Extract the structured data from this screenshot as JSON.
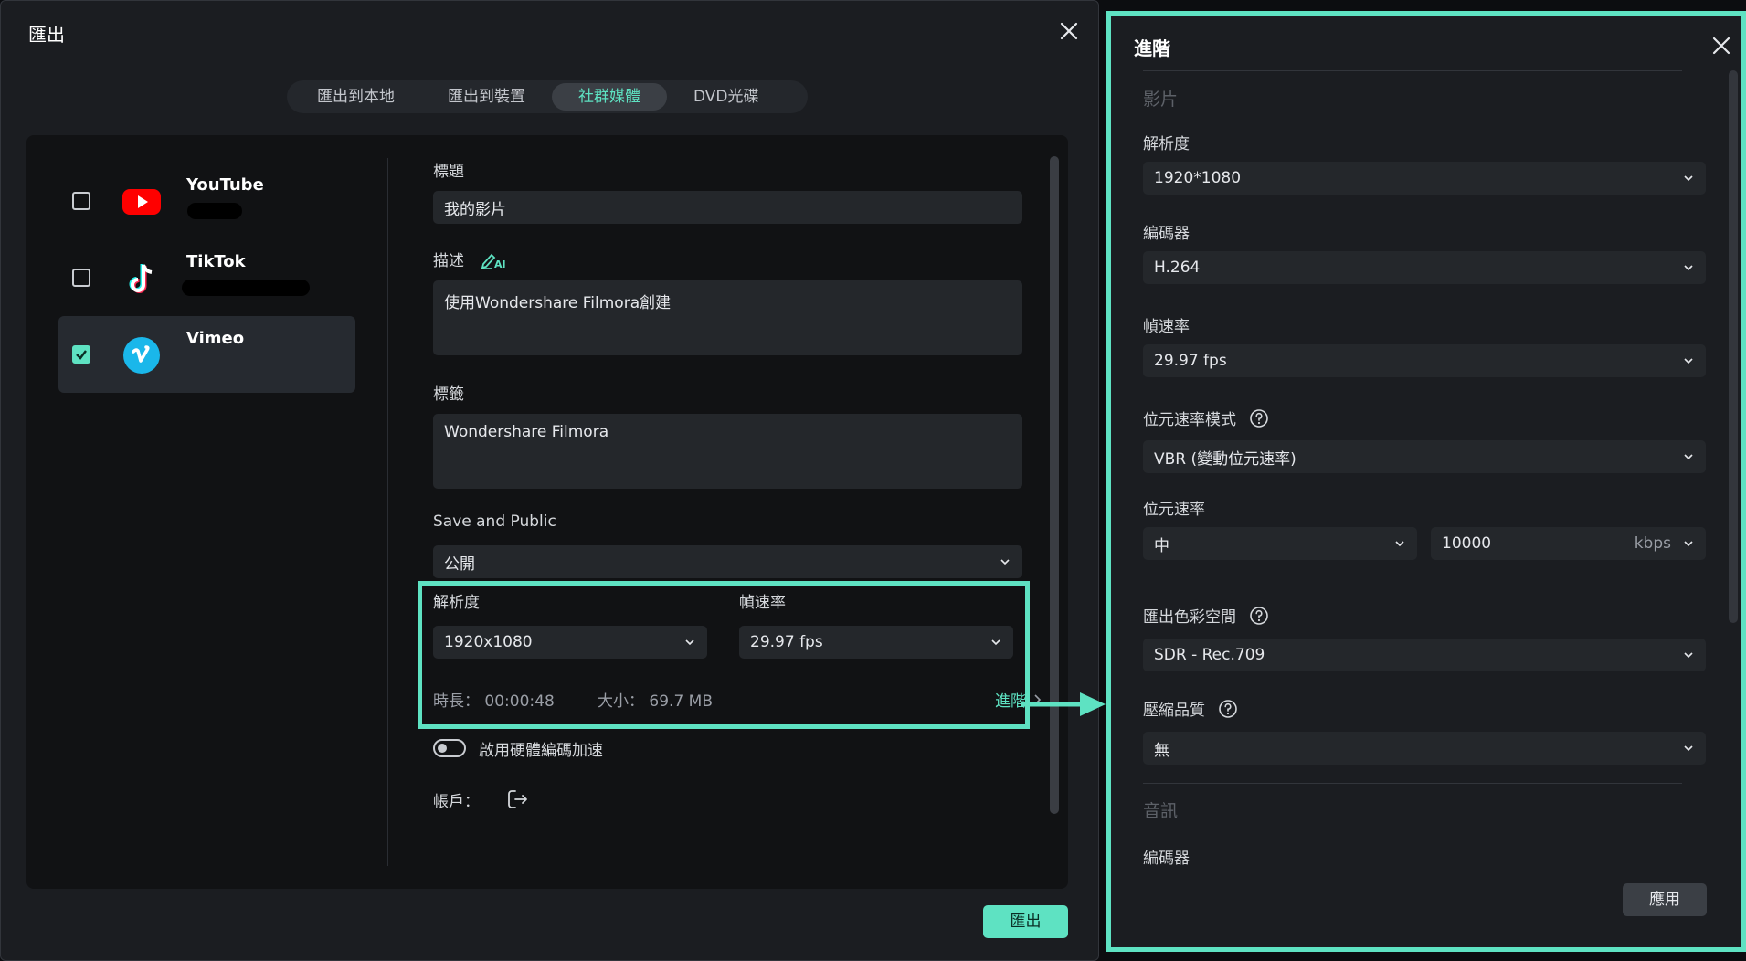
{
  "dialog": {
    "title": "匯出",
    "tabs": [
      "匯出到本地",
      "匯出到裝置",
      "社群媒體",
      "DVD光碟"
    ],
    "active_tab": "社群媒體",
    "platforms": [
      {
        "name": "YouTube",
        "checked": false
      },
      {
        "name": "TikTok",
        "checked": false
      },
      {
        "name": "Vimeo",
        "checked": true
      }
    ],
    "form": {
      "title_label": "標題",
      "title_value": "我的影片",
      "desc_label": "描述",
      "desc_value": "使用Wondershare Filmora創建",
      "tags_label": "標籤",
      "tags_value": "Wondershare Filmora",
      "privacy_label": "Save and Public",
      "privacy_value": "公開",
      "resolution_label": "解析度",
      "resolution_value": "1920x1080",
      "framerate_label": "幀速率",
      "framerate_value": "29.97 fps",
      "duration_label": "時長：",
      "duration_value": "00:00:48",
      "size_label": "大小：",
      "size_value": "69.7 MB",
      "advanced_link": "進階",
      "hw_accel_label": "啟用硬體編碼加速",
      "hw_accel_enabled": false,
      "account_label": "帳戶："
    },
    "export_button": "匯出"
  },
  "advanced_panel": {
    "title": "進階",
    "video_section": "影片",
    "resolution_label": "解析度",
    "resolution_value": "1920*1080",
    "encoder_label": "編碼器",
    "encoder_value": "H.264",
    "framerate_label": "幀速率",
    "framerate_value": "29.97 fps",
    "bitrate_mode_label": "位元速率模式",
    "bitrate_mode_value": "VBR (變動位元速率)",
    "bitrate_label": "位元速率",
    "bitrate_level": "中",
    "bitrate_value": "10000",
    "bitrate_unit": "kbps",
    "color_space_label": "匯出色彩空間",
    "color_space_value": "SDR - Rec.709",
    "compression_label": "壓縮品質",
    "compression_value": "無",
    "audio_section": "音訊",
    "audio_encoder_label": "編碼器",
    "apply_button": "應用"
  },
  "colors": {
    "accent": "#5ee2c2",
    "youtube_red": "#ff0000",
    "vimeo_blue": "#1ab7ea"
  }
}
